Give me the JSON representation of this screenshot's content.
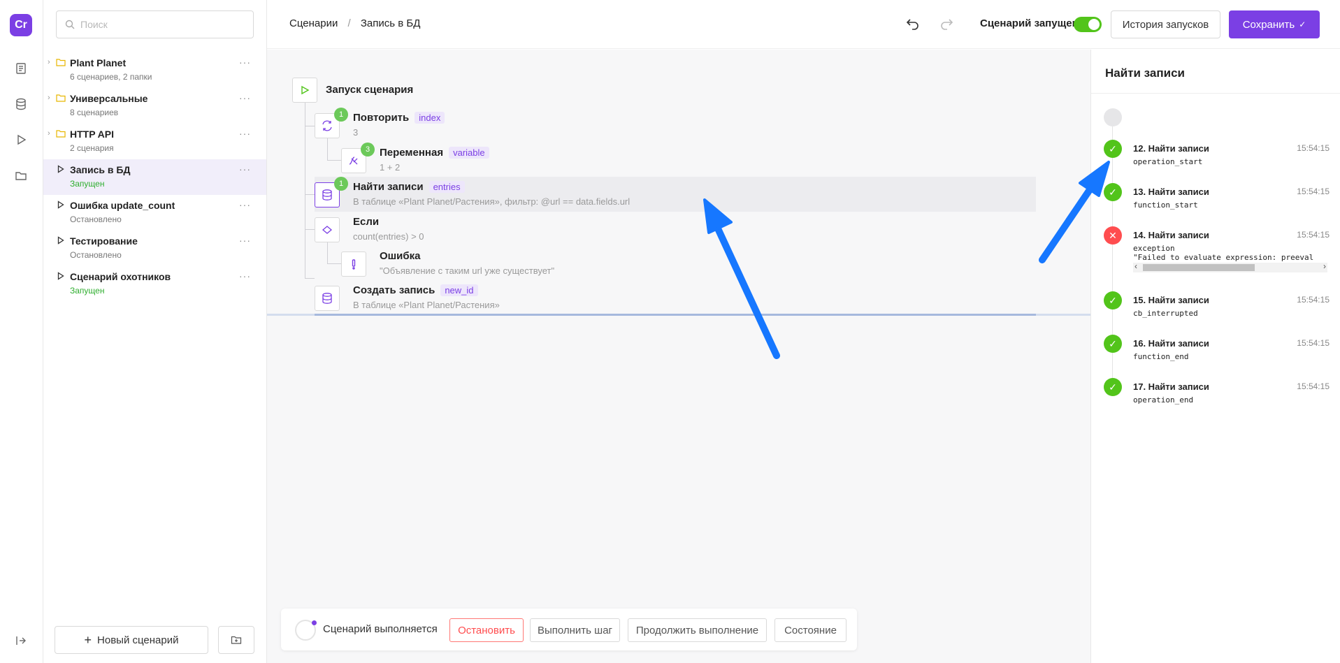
{
  "app": {
    "logo_text": "Cr"
  },
  "sidebar": {
    "search_placeholder": "Поиск",
    "items": [
      {
        "type": "folder",
        "title": "Plant Planet",
        "sub": "6 сценариев, 2 папки",
        "status": ""
      },
      {
        "type": "folder",
        "title": "Универсальные",
        "sub": "8 сценариев",
        "status": ""
      },
      {
        "type": "folder",
        "title": "HTTP API",
        "sub": "2 сценария",
        "status": ""
      },
      {
        "type": "scenario",
        "title": "Запись в БД",
        "sub": "Запущен",
        "status": "running",
        "active": true
      },
      {
        "type": "scenario",
        "title": "Ошибка update_count",
        "sub": "Остановлено",
        "status": "stopped"
      },
      {
        "type": "scenario",
        "title": "Тестирование",
        "sub": "Остановлено",
        "status": "stopped"
      },
      {
        "type": "scenario",
        "title": "Сценарий охотников",
        "sub": "Запущен",
        "status": "running"
      }
    ],
    "new_scenario_label": "Новый сценарий",
    "more_label": "···"
  },
  "header": {
    "breadcrumb": [
      "Сценарии",
      "Запись в БД"
    ],
    "breadcrumb_sep": "/",
    "run_label": "Сценарий запущен",
    "run_toggle_on": true,
    "history_label": "История запусков",
    "save_label": "Сохранить"
  },
  "flow": {
    "start_label": "Запуск сценария",
    "nodes": [
      {
        "title": "Повторить",
        "tag": "index",
        "sub": "3",
        "badge": "1",
        "icon": "repeat-icon"
      },
      {
        "title": "Переменная",
        "tag": "variable",
        "sub": "1 + 2",
        "badge": "3",
        "icon": "variable-icon"
      },
      {
        "title": "Найти записи",
        "tag": "entries",
        "sub": "В таблице «Plant Planet/Растения», фильтр: @url == data.fields.url",
        "badge": "1",
        "icon": "database-icon",
        "selected": true
      },
      {
        "title": "Если",
        "tag": "",
        "sub": "count(entries) > 0",
        "badge": "",
        "icon": "condition-icon"
      },
      {
        "title": "Ошибка",
        "tag": "",
        "sub": "\"Объявление с таким url уже существует\"",
        "badge": "",
        "icon": "error-icon"
      },
      {
        "title": "Создать запись",
        "tag": "new_id",
        "sub": "В таблице «Plant Planet/Растения»",
        "badge": "",
        "icon": "database-icon"
      }
    ]
  },
  "runbar": {
    "status": "Сценарий выполняется",
    "stop_label": "Остановить",
    "step_label": "Выполнить шаг",
    "continue_label": "Продолжить выполнение",
    "state_label": "Состояние"
  },
  "panel": {
    "title": "Найти записи",
    "logs": [
      {
        "name": "12. Найти записи",
        "time": "15:54:15",
        "code": "operation_start",
        "status": "ok"
      },
      {
        "name": "13. Найти записи",
        "time": "15:54:15",
        "code": "function_start",
        "status": "ok"
      },
      {
        "name": "14. Найти записи",
        "time": "15:54:15",
        "code": "exception\n\"Failed to evaluate expression: preeval",
        "status": "error"
      },
      {
        "name": "15. Найти записи",
        "time": "15:54:15",
        "code": "cb_interrupted",
        "status": "ok"
      },
      {
        "name": "16. Найти записи",
        "time": "15:54:15",
        "code": "function_end",
        "status": "ok"
      },
      {
        "name": "17. Найти записи",
        "time": "15:54:15",
        "code": "operation_end",
        "status": "ok"
      }
    ]
  },
  "colors": {
    "accent": "#7b3fe4",
    "success": "#52c41a",
    "danger": "#ff4d4f",
    "annotation_arrow": "#1677ff"
  }
}
